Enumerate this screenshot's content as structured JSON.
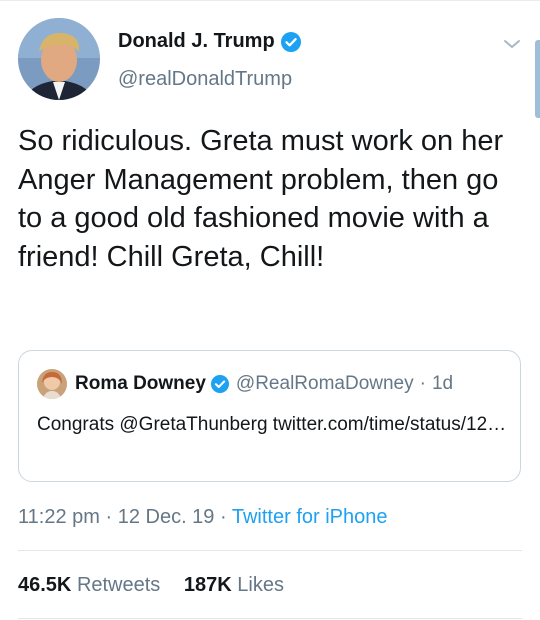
{
  "tweet": {
    "author": {
      "name": "Donald J. Trump",
      "handle": "@realDonaldTrump",
      "verified_icon": "verified-badge-icon"
    },
    "text": "So ridiculous. Greta must work on her Anger Management problem, then go to a good old fashioned movie with a friend! Chill Greta, Chill!",
    "quoted": {
      "author_name": "Roma Downey",
      "author_handle": "@RealRomaDowney",
      "age": "1d",
      "separator": "·",
      "text": "Congrats @GretaThunberg twitter.com/time/status/12…"
    },
    "meta": {
      "time": "11:22 pm",
      "date": "12 Dec. 19",
      "separator": "·",
      "source": "Twitter for iPhone"
    },
    "stats": {
      "retweets_count": "46.5K",
      "retweets_label": "Retweets",
      "likes_count": "187K",
      "likes_label": "Likes"
    }
  },
  "colors": {
    "accent": "#1da1f2",
    "secondary_text": "#657786",
    "primary_text": "#14171a",
    "border": "#ccd6dd"
  }
}
